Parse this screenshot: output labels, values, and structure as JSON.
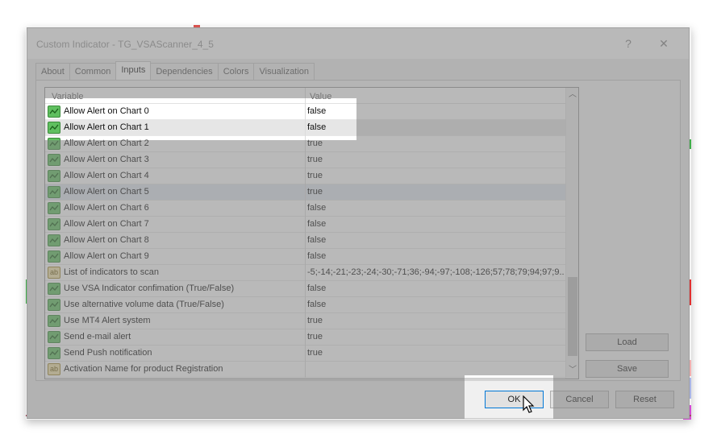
{
  "window": {
    "title": "Custom Indicator - TG_VSAScanner_4_5",
    "help_label": "?",
    "close_label": "✕"
  },
  "tabs": [
    {
      "label": "About"
    },
    {
      "label": "Common"
    },
    {
      "label": "Inputs",
      "active": true
    },
    {
      "label": "Dependencies"
    },
    {
      "label": "Colors"
    },
    {
      "label": "Visualization"
    }
  ],
  "grid": {
    "columns": {
      "variable": "Variable",
      "value": "Value"
    },
    "rows": [
      {
        "icon": "bool-icon",
        "name": "Allow Alert on Chart 0",
        "value": "false"
      },
      {
        "icon": "bool-icon",
        "name": "Allow Alert on Chart 1",
        "value": "false"
      },
      {
        "icon": "bool-icon",
        "name": "Allow Alert on Chart 2",
        "value": "true"
      },
      {
        "icon": "bool-icon",
        "name": "Allow Alert on Chart 3",
        "value": "true"
      },
      {
        "icon": "bool-icon",
        "name": "Allow Alert on Chart 4",
        "value": "true"
      },
      {
        "icon": "bool-icon",
        "name": "Allow Alert on Chart 5",
        "value": "true"
      },
      {
        "icon": "bool-icon",
        "name": "Allow Alert on Chart 6",
        "value": "false"
      },
      {
        "icon": "bool-icon",
        "name": "Allow Alert on Chart 7",
        "value": "false"
      },
      {
        "icon": "bool-icon",
        "name": "Allow Alert on Chart 8",
        "value": "false"
      },
      {
        "icon": "bool-icon",
        "name": "Allow Alert on Chart 9",
        "value": "false"
      },
      {
        "icon": "string-icon",
        "icon_text": "ab",
        "name": "List of indicators to scan",
        "value": "-5;-14;-21;-23;-24;-30;-71;36;-94;-97;-108;-126;57;78;79;94;97;9..."
      },
      {
        "icon": "bool-icon",
        "name": "Use VSA Indicator confimation (True/False)",
        "value": "false"
      },
      {
        "icon": "bool-icon",
        "name": "Use alternative volume data (True/False)",
        "value": "false"
      },
      {
        "icon": "bool-icon",
        "name": "Use MT4 Alert system",
        "value": "true"
      },
      {
        "icon": "bool-icon",
        "name": "Send e-mail alert",
        "value": "true"
      },
      {
        "icon": "bool-icon",
        "name": "Send Push notification",
        "value": "true"
      },
      {
        "icon": "string-icon",
        "icon_text": "ab",
        "name": "Activation Name for product Registration",
        "value": ""
      }
    ]
  },
  "side_buttons": {
    "load": "Load",
    "save": "Save"
  },
  "footer_buttons": {
    "ok": "OK",
    "cancel": "Cancel",
    "reset": "Reset"
  },
  "colors": {
    "accent": "#0078d7",
    "bool_icon": "#5fbf5f",
    "string_icon": "#f2e3a8"
  }
}
